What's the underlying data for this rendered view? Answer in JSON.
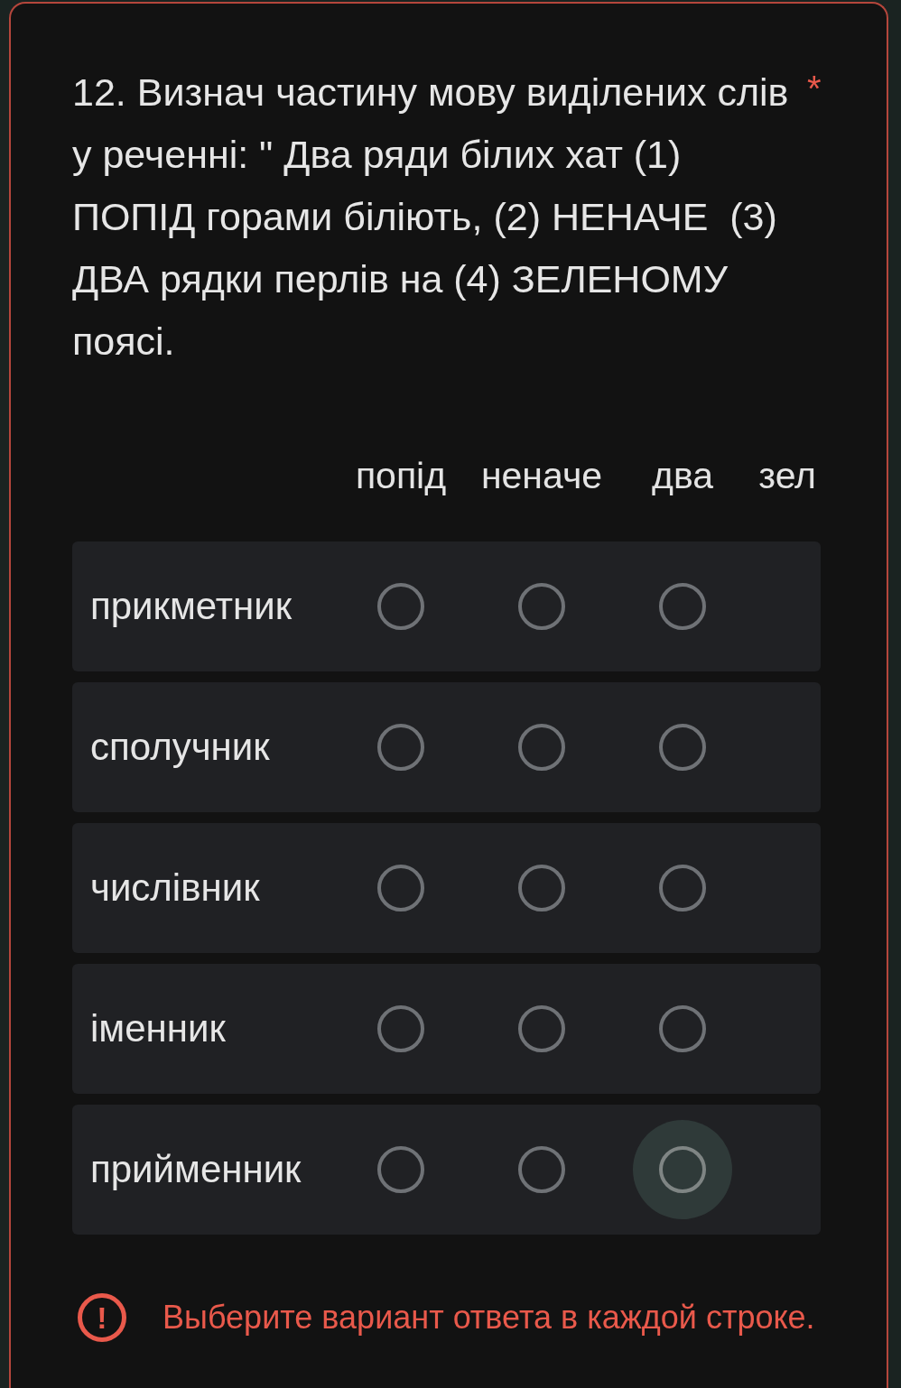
{
  "question": {
    "text": "12. Визнач частину мову виділених слів у реченні: \" Два ряди білих хат (1) ПОПІД горами біліють, (2) НЕНАЧЕ  (3) ДВА рядки перлів на (4) ЗЕЛЕНОМУ поясі.",
    "required_mark": "*"
  },
  "grid": {
    "columns": [
      "попід",
      "неначе",
      "два",
      "зел"
    ],
    "rows": [
      {
        "label": "прикметник",
        "options": [
          {
            "selected": false,
            "focused": false
          },
          {
            "selected": false,
            "focused": false
          },
          {
            "selected": false,
            "focused": false
          }
        ]
      },
      {
        "label": "сполучник",
        "options": [
          {
            "selected": false,
            "focused": false
          },
          {
            "selected": false,
            "focused": false
          },
          {
            "selected": false,
            "focused": false
          }
        ]
      },
      {
        "label": "числівник",
        "options": [
          {
            "selected": false,
            "focused": false
          },
          {
            "selected": false,
            "focused": false
          },
          {
            "selected": false,
            "focused": false
          }
        ]
      },
      {
        "label": "іменник",
        "options": [
          {
            "selected": false,
            "focused": false
          },
          {
            "selected": false,
            "focused": false
          },
          {
            "selected": false,
            "focused": false
          }
        ]
      },
      {
        "label": "прийменник",
        "options": [
          {
            "selected": false,
            "focused": false
          },
          {
            "selected": false,
            "focused": false
          },
          {
            "selected": false,
            "focused": true
          }
        ]
      }
    ]
  },
  "error": {
    "icon": "!",
    "text": "Выберите вариант ответа в каждой строке."
  }
}
